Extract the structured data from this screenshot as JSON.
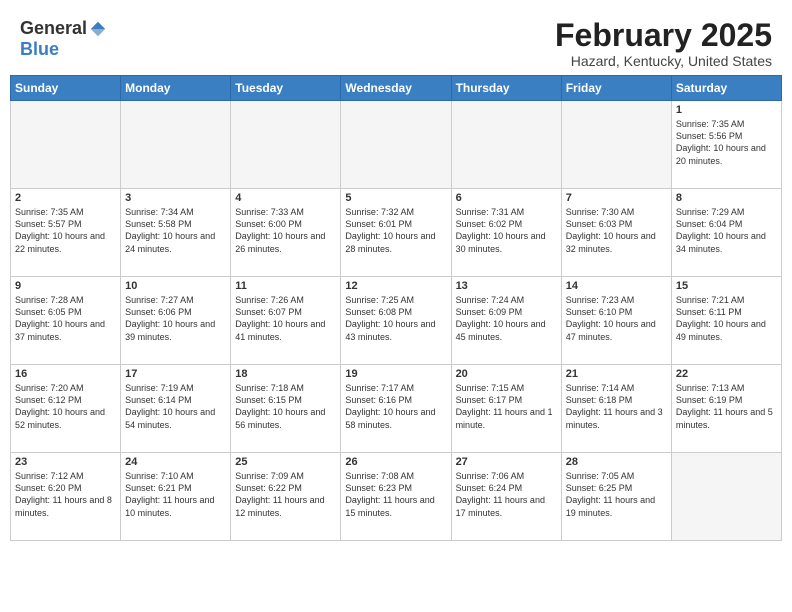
{
  "header": {
    "logo_general": "General",
    "logo_blue": "Blue",
    "month_title": "February 2025",
    "location": "Hazard, Kentucky, United States"
  },
  "days_of_week": [
    "Sunday",
    "Monday",
    "Tuesday",
    "Wednesday",
    "Thursday",
    "Friday",
    "Saturday"
  ],
  "weeks": [
    [
      {
        "day": "",
        "info": ""
      },
      {
        "day": "",
        "info": ""
      },
      {
        "day": "",
        "info": ""
      },
      {
        "day": "",
        "info": ""
      },
      {
        "day": "",
        "info": ""
      },
      {
        "day": "",
        "info": ""
      },
      {
        "day": "1",
        "info": "Sunrise: 7:35 AM\nSunset: 5:56 PM\nDaylight: 10 hours and 20 minutes."
      }
    ],
    [
      {
        "day": "2",
        "info": "Sunrise: 7:35 AM\nSunset: 5:57 PM\nDaylight: 10 hours and 22 minutes."
      },
      {
        "day": "3",
        "info": "Sunrise: 7:34 AM\nSunset: 5:58 PM\nDaylight: 10 hours and 24 minutes."
      },
      {
        "day": "4",
        "info": "Sunrise: 7:33 AM\nSunset: 6:00 PM\nDaylight: 10 hours and 26 minutes."
      },
      {
        "day": "5",
        "info": "Sunrise: 7:32 AM\nSunset: 6:01 PM\nDaylight: 10 hours and 28 minutes."
      },
      {
        "day": "6",
        "info": "Sunrise: 7:31 AM\nSunset: 6:02 PM\nDaylight: 10 hours and 30 minutes."
      },
      {
        "day": "7",
        "info": "Sunrise: 7:30 AM\nSunset: 6:03 PM\nDaylight: 10 hours and 32 minutes."
      },
      {
        "day": "8",
        "info": "Sunrise: 7:29 AM\nSunset: 6:04 PM\nDaylight: 10 hours and 34 minutes."
      }
    ],
    [
      {
        "day": "9",
        "info": "Sunrise: 7:28 AM\nSunset: 6:05 PM\nDaylight: 10 hours and 37 minutes."
      },
      {
        "day": "10",
        "info": "Sunrise: 7:27 AM\nSunset: 6:06 PM\nDaylight: 10 hours and 39 minutes."
      },
      {
        "day": "11",
        "info": "Sunrise: 7:26 AM\nSunset: 6:07 PM\nDaylight: 10 hours and 41 minutes."
      },
      {
        "day": "12",
        "info": "Sunrise: 7:25 AM\nSunset: 6:08 PM\nDaylight: 10 hours and 43 minutes."
      },
      {
        "day": "13",
        "info": "Sunrise: 7:24 AM\nSunset: 6:09 PM\nDaylight: 10 hours and 45 minutes."
      },
      {
        "day": "14",
        "info": "Sunrise: 7:23 AM\nSunset: 6:10 PM\nDaylight: 10 hours and 47 minutes."
      },
      {
        "day": "15",
        "info": "Sunrise: 7:21 AM\nSunset: 6:11 PM\nDaylight: 10 hours and 49 minutes."
      }
    ],
    [
      {
        "day": "16",
        "info": "Sunrise: 7:20 AM\nSunset: 6:12 PM\nDaylight: 10 hours and 52 minutes."
      },
      {
        "day": "17",
        "info": "Sunrise: 7:19 AM\nSunset: 6:14 PM\nDaylight: 10 hours and 54 minutes."
      },
      {
        "day": "18",
        "info": "Sunrise: 7:18 AM\nSunset: 6:15 PM\nDaylight: 10 hours and 56 minutes."
      },
      {
        "day": "19",
        "info": "Sunrise: 7:17 AM\nSunset: 6:16 PM\nDaylight: 10 hours and 58 minutes."
      },
      {
        "day": "20",
        "info": "Sunrise: 7:15 AM\nSunset: 6:17 PM\nDaylight: 11 hours and 1 minute."
      },
      {
        "day": "21",
        "info": "Sunrise: 7:14 AM\nSunset: 6:18 PM\nDaylight: 11 hours and 3 minutes."
      },
      {
        "day": "22",
        "info": "Sunrise: 7:13 AM\nSunset: 6:19 PM\nDaylight: 11 hours and 5 minutes."
      }
    ],
    [
      {
        "day": "23",
        "info": "Sunrise: 7:12 AM\nSunset: 6:20 PM\nDaylight: 11 hours and 8 minutes."
      },
      {
        "day": "24",
        "info": "Sunrise: 7:10 AM\nSunset: 6:21 PM\nDaylight: 11 hours and 10 minutes."
      },
      {
        "day": "25",
        "info": "Sunrise: 7:09 AM\nSunset: 6:22 PM\nDaylight: 11 hours and 12 minutes."
      },
      {
        "day": "26",
        "info": "Sunrise: 7:08 AM\nSunset: 6:23 PM\nDaylight: 11 hours and 15 minutes."
      },
      {
        "day": "27",
        "info": "Sunrise: 7:06 AM\nSunset: 6:24 PM\nDaylight: 11 hours and 17 minutes."
      },
      {
        "day": "28",
        "info": "Sunrise: 7:05 AM\nSunset: 6:25 PM\nDaylight: 11 hours and 19 minutes."
      },
      {
        "day": "",
        "info": ""
      }
    ]
  ]
}
